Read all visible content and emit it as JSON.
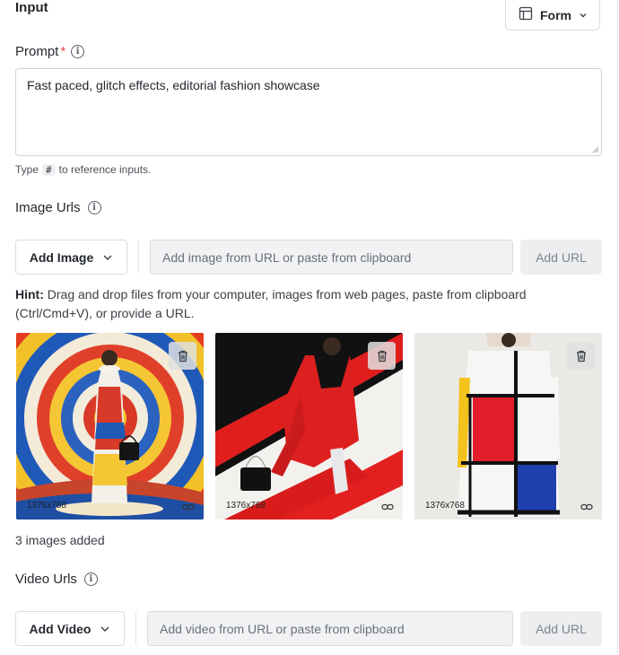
{
  "section": {
    "title": "Input"
  },
  "form_toggle": {
    "label": "Form",
    "icon": "layout-icon"
  },
  "prompt": {
    "label": "Prompt",
    "required_mark": "*",
    "value": "Fast paced, glitch effects, editorial fashion showcase",
    "help_prefix": "Type",
    "help_key": "#",
    "help_suffix": "to reference inputs."
  },
  "image_urls": {
    "label": "Image Urls",
    "add_button": "Add Image",
    "url_placeholder": "Add image from URL or paste from clipboard",
    "add_url_button": "Add URL",
    "hint_bold": "Hint:",
    "hint_text": "Drag and drop files from your computer, images from web pages, paste from clipboard (Ctrl/Cmd+V), or provide a URL.",
    "thumbnails": [
      {
        "dimensions": "1376x768",
        "alt": "Model in colorful spiral patterned dress against concentric circle backdrop"
      },
      {
        "dimensions": "1376x768",
        "alt": "Model in red and black outfit with diagonal red stripe background"
      },
      {
        "dimensions": "1376x768",
        "alt": "Model in Mondrian style color block dress"
      }
    ],
    "count_text": "3 images added"
  },
  "video_urls": {
    "label": "Video Urls",
    "add_button": "Add Video",
    "url_placeholder": "Add video from URL or paste from clipboard",
    "add_url_button": "Add URL"
  },
  "colors": {
    "accent_required": "#e5484d",
    "input_bg": "#f1f2f4",
    "border": "#d8dbe0"
  }
}
